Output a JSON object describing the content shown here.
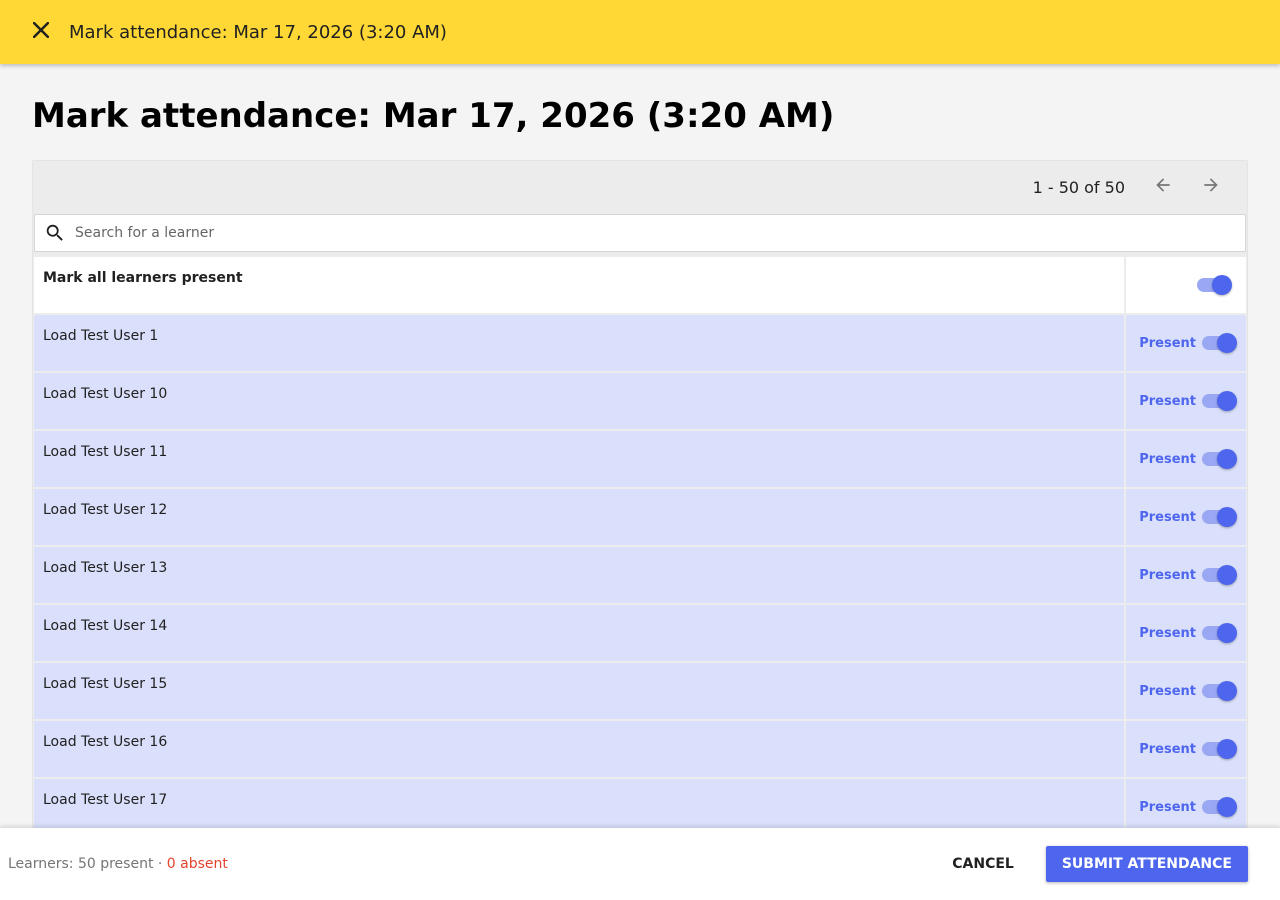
{
  "appbar": {
    "title": "Mark attendance: Mar 17, 2026 (3:20 AM)",
    "close_icon": "close-icon"
  },
  "page": {
    "title": "Mark attendance: Mar 17, 2026 (3:20 AM)"
  },
  "pager": {
    "range_text": "1 - 50 of 50",
    "prev_icon": "arrow-back-icon",
    "next_icon": "arrow-forward-icon"
  },
  "search": {
    "placeholder": "Search for a learner",
    "value": "",
    "icon": "search-icon"
  },
  "mark_all": {
    "label": "Mark all learners present",
    "checked": true
  },
  "learners": [
    {
      "name": "Load Test User 1",
      "status": "Present"
    },
    {
      "name": "Load Test User 10",
      "status": "Present"
    },
    {
      "name": "Load Test User 11",
      "status": "Present"
    },
    {
      "name": "Load Test User 12",
      "status": "Present"
    },
    {
      "name": "Load Test User 13",
      "status": "Present"
    },
    {
      "name": "Load Test User 14",
      "status": "Present"
    },
    {
      "name": "Load Test User 15",
      "status": "Present"
    },
    {
      "name": "Load Test User 16",
      "status": "Present"
    },
    {
      "name": "Load Test User 17",
      "status": "Present"
    }
  ],
  "footer": {
    "summary_prefix": "Learners: 50 present · ",
    "absent_text": "0 absent",
    "cancel_label": "CANCEL",
    "submit_label": "SUBMIT ATTENDANCE"
  },
  "colors": {
    "appbar": "#ffd835",
    "accent": "#4e66ee",
    "row_selected": "#dae0fb",
    "absent": "#e4432d"
  }
}
